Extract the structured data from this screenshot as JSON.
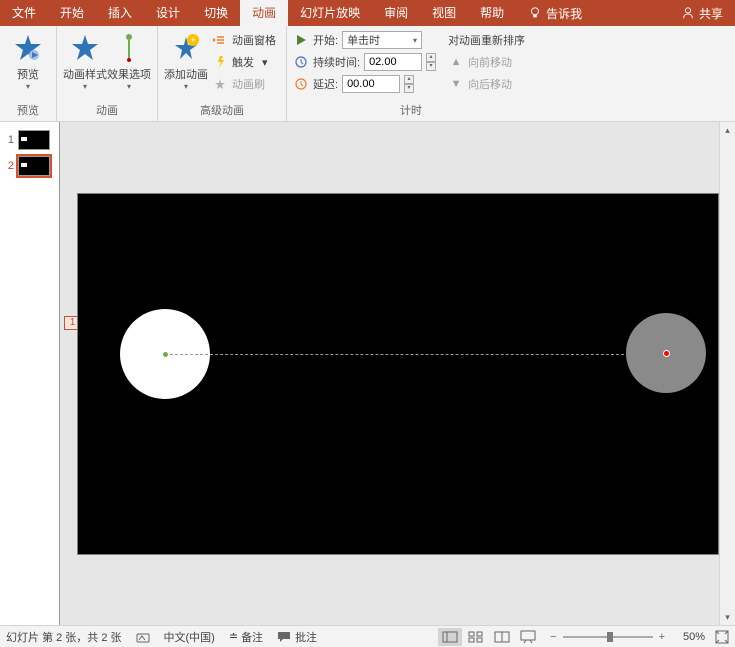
{
  "menubar": {
    "tabs": [
      "文件",
      "开始",
      "插入",
      "设计",
      "切换",
      "动画",
      "幻灯片放映",
      "审阅",
      "视图",
      "帮助"
    ],
    "tellme": "告诉我",
    "share": "共享"
  },
  "ribbon": {
    "preview": {
      "label": "预览",
      "group": "预览"
    },
    "animation": {
      "style": "动画样式",
      "effect": "效果选项",
      "group": "动画"
    },
    "advanced": {
      "add": "添加动画",
      "pane": "动画窗格",
      "trigger": "触发",
      "painter": "动画刷",
      "group": "高级动画"
    },
    "timing": {
      "group": "计时",
      "start_label": "开始:",
      "start_value": "单击时",
      "duration_label": "持续时间:",
      "duration_value": "02.00",
      "delay_label": "延迟:",
      "delay_value": "00.00",
      "reorder": "对动画重新排序",
      "forward": "向前移动",
      "backward": "向后移动"
    }
  },
  "thumbs": {
    "items": [
      "1",
      "2"
    ]
  },
  "slide": {
    "anim_tag": "1"
  },
  "status": {
    "slide_info": "幻灯片 第 2 张，共 2 张",
    "lang": "中文(中国)",
    "notes": "备注",
    "comments": "批注",
    "zoom": "50%"
  }
}
